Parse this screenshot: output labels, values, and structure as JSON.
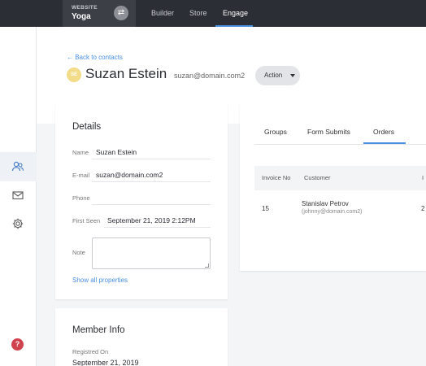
{
  "topbar": {
    "site_kicker": "WEBSITE",
    "site_name": "Yoga",
    "nav": [
      "Builder",
      "Store",
      "Engage"
    ],
    "active_nav": "Engage",
    "accent": "#4a90e2"
  },
  "header": {
    "back_link": "← Back to contacts",
    "avatar_initials": "SE",
    "name": "Suzan Estein",
    "email": "suzan@domain.com2",
    "action_label": "Action"
  },
  "details": {
    "title": "Details",
    "fields": [
      {
        "label": "Name",
        "value": "Suzan Estein"
      },
      {
        "label": "E-mail",
        "value": "suzan@domain.com2"
      },
      {
        "label": "Phone",
        "value": ""
      },
      {
        "label": "First Seen",
        "value": "September 21, 2019 2:12PM"
      },
      {
        "label": "Note",
        "value": ""
      }
    ],
    "show_all": "Show all properties"
  },
  "member": {
    "title": "Member Info",
    "registered_label": "Registred On",
    "registered_value": "September 21, 2019"
  },
  "tabs": [
    "Groups",
    "Form Submits",
    "Orders"
  ],
  "active_tab": "Orders",
  "orders": {
    "columns": [
      "Invoice No",
      "Customer",
      "I"
    ],
    "rows": [
      {
        "invoice": "15",
        "customer_name": "Stanislav Petrov",
        "customer_email": "(johnny@domain.com2)",
        "extra": "2"
      }
    ]
  },
  "rail_icons": [
    "contacts-icon",
    "mail-icon",
    "settings-icon"
  ],
  "help_glyph": "?"
}
